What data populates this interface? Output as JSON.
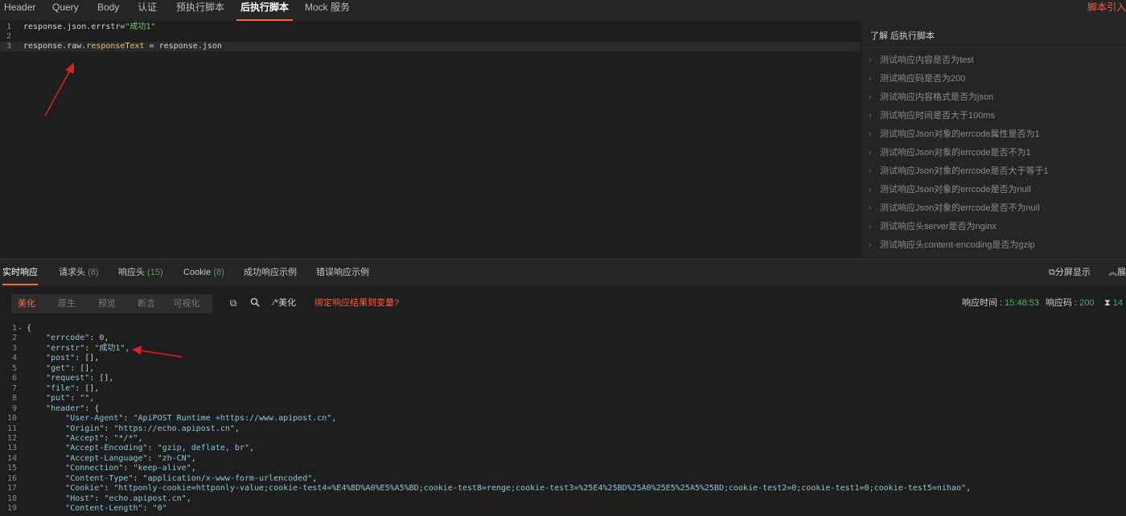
{
  "request_tabs": [
    {
      "label": "Header"
    },
    {
      "label": "Query"
    },
    {
      "label": "Body"
    },
    {
      "label": "认证"
    },
    {
      "label": "预执行脚本"
    },
    {
      "label": "后执行脚本",
      "active": true
    },
    {
      "label": "Mock 服务"
    }
  ],
  "top_right_link": "脚本引入",
  "script_editor": {
    "lines": [
      {
        "num": "1",
        "code": "response.json.errstr=",
        "str": "\"成功1\""
      },
      {
        "num": "2",
        "code": ""
      },
      {
        "num": "3",
        "pre": "response.raw.",
        "prop": "responseText",
        "post": " = response.json"
      }
    ]
  },
  "snippets": {
    "title": "了解 后执行脚本",
    "items": [
      "测试响应内容是否为test",
      "测试响应码是否为200",
      "测试响应内容格式是否为json",
      "测试响应时间是否大于100ms",
      "测试响应Json对象的errcode属性是否为1",
      "测试响应Json对象的errcode是否不为1",
      "测试响应Json对象的errcode是否大于等于1",
      "测试响应Json对象的errcode是否为null",
      "测试响应Json对象的errcode是否不为null",
      "测试响应头server是否为nginx",
      "测试响应头content-encoding是否为gzip"
    ]
  },
  "response_tabs": [
    {
      "label": "实时响应",
      "active": true
    },
    {
      "label": "请求头",
      "count": "(8)"
    },
    {
      "label": "响应头",
      "count": "(15)"
    },
    {
      "label": "Cookie",
      "count": "(8)"
    },
    {
      "label": "成功响应示例"
    },
    {
      "label": "错误响应示例"
    }
  ],
  "split_view_label": "分屏显示",
  "expand_label": "展",
  "view_modes": [
    {
      "label": "美化",
      "active": true
    },
    {
      "label": "原生"
    },
    {
      "label": "预览"
    },
    {
      "label": "断言"
    },
    {
      "label": "可视化"
    }
  ],
  "toolbar": {
    "beautify_label": "美化",
    "bind_label": "绑定响应结果到变量?"
  },
  "status": {
    "time_label": "响应时间 : ",
    "time_value": "15:48:53",
    "code_label": "响应码 : ",
    "code_value": "200",
    "duration_value": "14"
  },
  "icons": {
    "copy": "copy-icon",
    "search": "search-icon",
    "beautify": "magic-wand-icon",
    "split": "split-screen-icon",
    "expand": "expand-icon",
    "hourglass": "hourglass-icon"
  },
  "colors": {
    "accent": "#ff6a3d",
    "link_red": "#ff5b3a",
    "success_green": "#4db06f",
    "arrow_red": "#e02020"
  },
  "json_lines": [
    {
      "num": "1",
      "fold": true,
      "t": "{"
    },
    {
      "num": "2",
      "ind": 1,
      "k": "\"errcode\"",
      "n": "0",
      "end": ","
    },
    {
      "num": "3",
      "ind": 1,
      "k": "\"errstr\"",
      "s": "\"成功1\"",
      "end": ","
    },
    {
      "num": "4",
      "ind": 1,
      "k": "\"post\"",
      "t": "[],"
    },
    {
      "num": "5",
      "ind": 1,
      "k": "\"get\"",
      "t": "[],"
    },
    {
      "num": "6",
      "ind": 1,
      "k": "\"request\"",
      "t": "[],"
    },
    {
      "num": "7",
      "ind": 1,
      "k": "\"file\"",
      "t": "[],"
    },
    {
      "num": "8",
      "ind": 1,
      "k": "\"put\"",
      "s": "\"\"",
      "end": ","
    },
    {
      "num": "9",
      "ind": 1,
      "fold": true,
      "k": "\"header\"",
      "t": "{"
    },
    {
      "num": "10",
      "ind": 2,
      "k": "\"User-Agent\"",
      "s": "\"ApiPOST Runtime +https://www.apipost.cn\"",
      "end": ","
    },
    {
      "num": "11",
      "ind": 2,
      "k": "\"Origin\"",
      "s": "\"https://echo.apipost.cn\"",
      "end": ","
    },
    {
      "num": "12",
      "ind": 2,
      "k": "\"Accept\"",
      "s": "\"*/*\"",
      "end": ","
    },
    {
      "num": "13",
      "ind": 2,
      "k": "\"Accept-Encoding\"",
      "s": "\"gzip, deflate, br\"",
      "end": ","
    },
    {
      "num": "14",
      "ind": 2,
      "k": "\"Accept-Language\"",
      "s": "\"zh-CN\"",
      "end": ","
    },
    {
      "num": "15",
      "ind": 2,
      "k": "\"Connection\"",
      "s": "\"keep-alive\"",
      "end": ","
    },
    {
      "num": "16",
      "ind": 2,
      "k": "\"Content-Type\"",
      "s": "\"application/x-www-form-urlencoded\"",
      "end": ","
    },
    {
      "num": "17",
      "ind": 2,
      "k": "\"Cookie\"",
      "s": "\"httponly-cookie=httponly-value;cookie-test4=%E4%BD%A0%E5%A5%BD;cookie-test8=renge;cookie-test3=%25E4%25BD%25A0%25E5%25A5%25BD;cookie-test2=0;cookie-test1=0;cookie-test5=nihao\"",
      "end": ","
    },
    {
      "num": "18",
      "ind": 2,
      "k": "\"Host\"",
      "s": "\"echo.apipost.cn\"",
      "end": ","
    },
    {
      "num": "19",
      "ind": 2,
      "k": "\"Content-Length\"",
      "s": "\"0\""
    }
  ]
}
